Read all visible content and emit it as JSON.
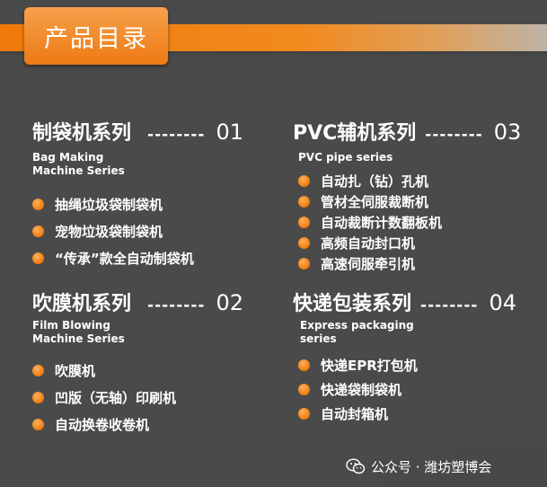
{
  "header": {
    "title": "产品目录"
  },
  "sections": [
    {
      "title": "制袋机系列",
      "dashes": "--------",
      "number": "01",
      "subtitle": "Bag Making\nMachine Series",
      "items": [
        "抽绳垃圾袋制袋机",
        "宠物垃圾袋制袋机",
        "“传承”款全自动制袋机"
      ]
    },
    {
      "title": "PVC辅机系列",
      "dashes": "--------",
      "number": "03",
      "subtitle": "PVC pipe series",
      "items": [
        "自动扎（钻）孔机",
        "管材全伺服裁断机",
        "自动裁断计数翻板机",
        "高频自动封口机",
        "高速伺服牵引机"
      ]
    },
    {
      "title": "吹膜机系列",
      "dashes": "--------",
      "number": "02",
      "subtitle": "Film Blowing\nMachine Series",
      "items": [
        "吹膜机",
        "凹版（无轴）印刷机",
        "自动换卷收卷机"
      ]
    },
    {
      "title": "快递包装系列",
      "dashes": "--------",
      "number": "04",
      "subtitle": "Express packaging\nseries",
      "items": [
        "快递EPR打包机",
        "快递袋制袋机",
        "自动封箱机"
      ]
    }
  ],
  "footer": {
    "text": "公众号 · 潍坊塑博会",
    "icon": "wechat-icon"
  },
  "colors": {
    "background": "#4a4a4a",
    "accent": "#f07a0a",
    "text": "#ffffff"
  }
}
